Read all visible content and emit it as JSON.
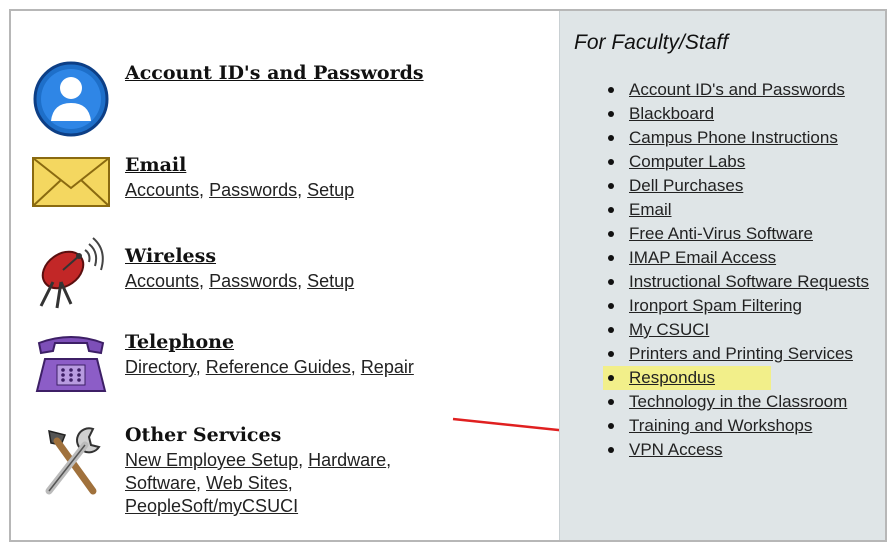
{
  "services": [
    {
      "title": "Account ID's and Passwords",
      "icon": "user-icon",
      "links": []
    },
    {
      "title": "Email ",
      "icon": "envelope-icon",
      "links": [
        "Accounts",
        "Passwords",
        "Setup"
      ]
    },
    {
      "title": "Wireless",
      "icon": "satellite-dish-icon",
      "links": [
        "Accounts",
        "Passwords",
        "Setup"
      ]
    },
    {
      "title": "Telephone",
      "icon": "telephone-icon",
      "links": [
        "Directory",
        "Reference Guides",
        "Repair"
      ]
    },
    {
      "title": "Other Services",
      "icon": "tools-icon",
      "links": [
        "New Employee Setup",
        "Hardware",
        "Software",
        "Web Sites",
        "PeopleSoft/myCSUCI"
      ]
    }
  ],
  "faculty": {
    "title": "For Faculty/Staff",
    "items": [
      "Account ID's and Passwords",
      "Blackboard",
      "Campus Phone Instructions",
      "Computer Labs",
      "Dell Purchases",
      "Email",
      "Free Anti-Virus Software",
      "IMAP Email Access",
      "Instructional Software Requests",
      "Ironport Spam Filtering",
      "My CSUCI",
      "Printers and Printing Services",
      "Respondus",
      "Technology in the Classroom",
      "Training and Workshops",
      "VPN Access"
    ]
  },
  "colors": {
    "highlight": "#f2ef8a",
    "arrow": "#e02020",
    "panel": "#dfe5e7"
  }
}
